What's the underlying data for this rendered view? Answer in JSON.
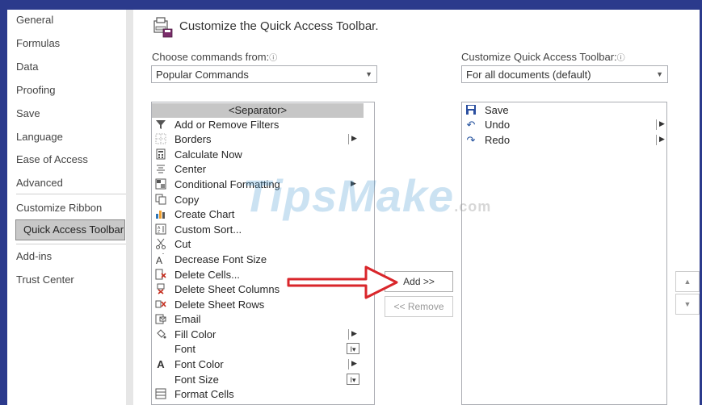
{
  "sidebar": {
    "items": [
      {
        "label": "General"
      },
      {
        "label": "Formulas"
      },
      {
        "label": "Data"
      },
      {
        "label": "Proofing"
      },
      {
        "label": "Save"
      },
      {
        "label": "Language"
      },
      {
        "label": "Ease of Access"
      },
      {
        "label": "Advanced"
      },
      {
        "label": "Customize Ribbon"
      },
      {
        "label": "Quick Access Toolbar",
        "selected": true
      },
      {
        "label": "Add-ins"
      },
      {
        "label": "Trust Center"
      }
    ]
  },
  "main": {
    "title": "Customize the Quick Access Toolbar.",
    "choose_label": "Choose commands from:",
    "choose_value": "Popular Commands",
    "customize_label": "Customize Quick Access Toolbar:",
    "customize_value": "For all documents (default)",
    "info_glyph": "ⓘ",
    "commands": [
      {
        "label": "<Separator>",
        "icon": "none"
      },
      {
        "label": "Add or Remove Filters",
        "icon": "filter-icon"
      },
      {
        "label": "Borders",
        "icon": "borders-icon",
        "submenu": true
      },
      {
        "label": "Calculate Now",
        "icon": "calculator-icon"
      },
      {
        "label": "Center",
        "icon": "align-center-icon"
      },
      {
        "label": "Conditional Formatting",
        "icon": "conditional-formatting-icon",
        "submenu": true
      },
      {
        "label": "Copy",
        "icon": "copy-icon"
      },
      {
        "label": "Create Chart",
        "icon": "chart-icon"
      },
      {
        "label": "Custom Sort...",
        "icon": "sort-icon"
      },
      {
        "label": "Cut",
        "icon": "scissors-icon"
      },
      {
        "label": "Decrease Font Size",
        "icon": "decrease-font-icon"
      },
      {
        "label": "Delete Cells...",
        "icon": "delete-cells-icon"
      },
      {
        "label": "Delete Sheet Columns",
        "icon": "delete-columns-icon"
      },
      {
        "label": "Delete Sheet Rows",
        "icon": "delete-rows-icon"
      },
      {
        "label": "Email",
        "icon": "email-icon"
      },
      {
        "label": "Fill Color",
        "icon": "fill-color-icon",
        "submenu": true
      },
      {
        "label": "Font",
        "icon": "none",
        "dropdown": true
      },
      {
        "label": "Font Color",
        "icon": "font-color-icon",
        "submenu": true
      },
      {
        "label": "Font Size",
        "icon": "none",
        "dropdown": true
      },
      {
        "label": "Format Cells",
        "icon": "format-cells-icon"
      }
    ],
    "add_button": "Add >>",
    "remove_button": "<< Remove",
    "toolbar_items": [
      {
        "label": "Save",
        "icon": "save-icon"
      },
      {
        "label": "Undo",
        "icon": "undo-icon",
        "submenu": true
      },
      {
        "label": "Redo",
        "icon": "redo-icon",
        "submenu": true
      }
    ]
  },
  "watermark": {
    "brand": "TipsMake",
    "suffix": ".com"
  },
  "colors": {
    "frame": "#2b3a8c",
    "selected_bg": "#c8c8c8",
    "separator_row": "#c6c6c6",
    "arrow": "#d9262b"
  }
}
